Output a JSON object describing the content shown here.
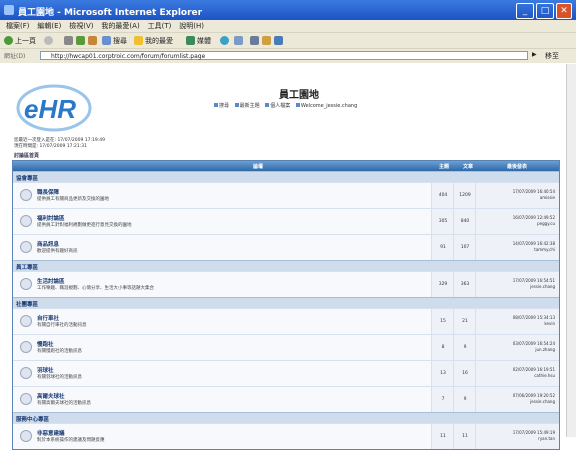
{
  "window": {
    "title": "員工園地 - Microsoft Internet Explorer",
    "min": "_",
    "max": "□",
    "close": "✕"
  },
  "menu": [
    "檔案(F)",
    "編輯(E)",
    "檢視(V)",
    "我的最愛(A)",
    "工具(T)",
    "說明(H)"
  ],
  "toolbar": {
    "back": "上一頁",
    "search": "搜尋",
    "favorites": "我的最愛",
    "media": "媒體"
  },
  "address": {
    "label": "網址(D)",
    "url": "http://hwcap01.corptroic.com/forum/forumlist.page",
    "go": "移至",
    "links": "連結"
  },
  "site": {
    "logo_text": "eHR",
    "title": "員工園地",
    "nav": [
      "搜尋",
      "最新主題",
      "個人檔案",
      "Welcome_jessie.chang"
    ]
  },
  "visits": [
    "您最近一次登入是在: 17/07/2009 17:19:49",
    "現在時間是: 17/07/2009 17:21:31"
  ],
  "forum_link": "討論區首頁",
  "table": {
    "headers": [
      "論壇",
      "主題",
      "文章",
      "最後發表"
    ],
    "categories": [
      {
        "name": "協會專區",
        "forums": [
          {
            "name": "職長保障",
            "desc": "提供員工有關商品更新及交換的園地",
            "topics": "404",
            "posts": "1209",
            "last_date": "17/07/2009 16:40:54",
            "last_user": "amissie"
          },
          {
            "name": "福利討論區",
            "desc": "提供員工針對福利規劃做更進行意見交換的園地",
            "topics": "305",
            "posts": "840",
            "last_date": "16/07/2009 12:49:52",
            "last_user": "peggy.cu"
          },
          {
            "name": "商品訊息",
            "desc": "歡迎提供有趣好商訊",
            "topics": "91",
            "posts": "107",
            "last_date": "14/07/2009 16:42:38",
            "last_user": "tammy.chi"
          }
        ]
      },
      {
        "name": "員工專區",
        "forums": [
          {
            "name": "生活討論區",
            "desc": "工作樂趣、職涯規劃、心情分享、生活大小事等話題大集合",
            "topics": "329",
            "posts": "363",
            "last_date": "17/07/2009 16:54:51",
            "last_user": "jessie.chang"
          }
        ]
      },
      {
        "name": "社團專區",
        "forums": [
          {
            "name": "自行車社",
            "desc": "有關自行車社的活動訊息",
            "topics": "15",
            "posts": "21",
            "last_date": "08/07/2009 15:34:13",
            "last_user": "kevin"
          },
          {
            "name": "慢跑社",
            "desc": "有關慢跑社的活動訊息",
            "topics": "8",
            "posts": "9",
            "last_date": "03/07/2009 16:54:24",
            "last_user": "jun.zhang"
          },
          {
            "name": "羽球社",
            "desc": "有關羽球社的活動訊息",
            "topics": "13",
            "posts": "16",
            "last_date": "02/07/2009 16:19:51",
            "last_user": "cathie.hsu"
          },
          {
            "name": "高爾夫球社",
            "desc": "有關高爾夫球社的活動訊息",
            "topics": "7",
            "posts": "9",
            "last_date": "07/06/2009 19:20:52",
            "last_user": "jessie.chang"
          }
        ]
      },
      {
        "name": "服務中心專區",
        "forums": [
          {
            "name": "非惡意建議",
            "desc": "對於本系統操作的建議及問題反應",
            "topics": "11",
            "posts": "11",
            "last_date": "17/07/2009 15:49:19",
            "last_user": "ryan.tan"
          }
        ]
      }
    ]
  }
}
